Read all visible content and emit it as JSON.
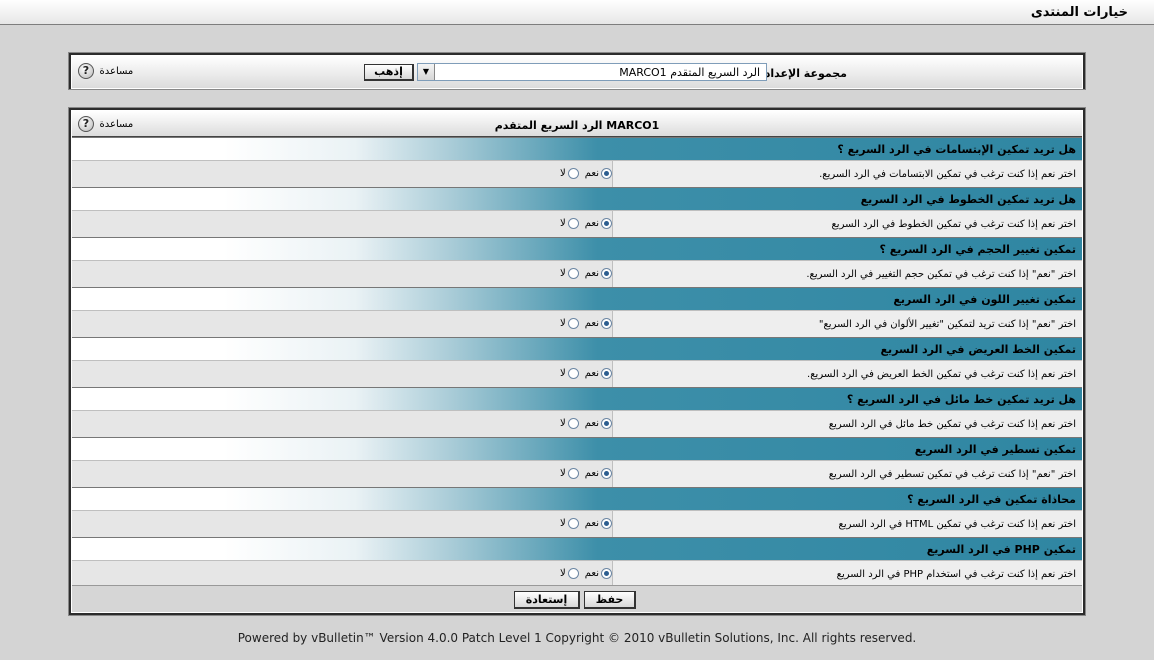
{
  "header": {
    "title": "خيارات المنتدى"
  },
  "group": {
    "label": "مجموعة الإعداد",
    "selected": "MARCO1 الرد السريع المتقدم",
    "go_label": "إذهب",
    "help_label": "مساعدة"
  },
  "main": {
    "title": "MARCO1 الرد السريع المتقدم",
    "help_label": "مساعدة",
    "options": [
      {
        "question": "هل تريد تمكين الإبتسامات في الرد السريع ؟",
        "description": "اختر نعم إذا كنت ترغب في تمكين الابتسامات في الرد السريع."
      },
      {
        "question": "هل تريد تمكين الخطوط في الرد السريع",
        "description": "اختر نعم إذا كنت ترغب في تمكين الخطوط في الرد السريع"
      },
      {
        "question": "تمكين تغيير الحجم في الرد السريع ؟",
        "description": "اختر \"نعم\" إذا كنت ترغب في تمكين حجم التغيير في الرد السريع."
      },
      {
        "question": "تمكين تغيير اللون في الرد السريع",
        "description": "اختر \"نعم\" إذا كنت تريد لتمكين \"تغيير الألوان في الرد السريع\""
      },
      {
        "question": "تمكين الخط العريض في الرد السريع",
        "description": "اختر نعم إذا كنت ترغب في تمكين الخط العريض في الرد السريع."
      },
      {
        "question": "هل تريد تمكين خط مائل في الرد السريع ؟",
        "description": "اختر نعم إذا كنت ترغب في تمكين خط مائل في الرد السريع"
      },
      {
        "question": "تمكين تسطير في الرد السريع",
        "description": "اختر \"نعم\" إذا كنت ترغب في تمكين تسطير في الرد السريع"
      },
      {
        "question": "محاذاة تمكين في الرد السريع ؟",
        "description": "اختر نعم إذا كنت ترغب في تمكين HTML في الرد السريع"
      },
      {
        "question": "تمكين PHP في الرد السريع",
        "description": "اختر نعم إذا كنت ترغب في استخدام PHP في الرد السريع"
      }
    ],
    "yes_label": "نعم",
    "no_label": "لا",
    "save_label": "حفظ",
    "restore_label": "إستعادة"
  },
  "footer": {
    "copyright": "Powered by vBulletin™ Version 4.0.0 Patch Level 1 Copyright © 2010 vBulletin Solutions, Inc. All rights reserved."
  }
}
